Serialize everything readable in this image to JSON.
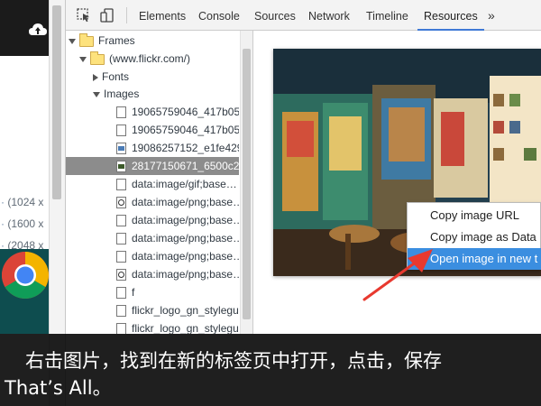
{
  "toolbar": {
    "tabs": [
      "Elements",
      "Console",
      "Sources",
      "Network",
      "Timeline",
      "Resources"
    ],
    "active_tab": "Resources",
    "more": "»"
  },
  "page_strip": {
    "resolutions": [
      "(1024 x",
      "(1600 x",
      "(2048 x"
    ]
  },
  "tree": {
    "frames": "Frames",
    "site": "(www.flickr.com/)",
    "fonts": "Fonts",
    "images": "Images",
    "items": [
      {
        "label": "19065759046_417b05",
        "icon": "file-icon"
      },
      {
        "label": "19065759046_417b05",
        "icon": "file-icon"
      },
      {
        "label": "19086257152_e1fe429",
        "icon": "image-icon"
      },
      {
        "label": "28177150671_6500c2",
        "icon": "image-icon",
        "selected": true
      },
      {
        "label": "data:image/gif;base…",
        "icon": "file-icon"
      },
      {
        "label": "data:image/png;base…",
        "icon": "search-file-icon"
      },
      {
        "label": "data:image/png;base…",
        "icon": "file-icon"
      },
      {
        "label": "data:image/png;base…",
        "icon": "file-icon"
      },
      {
        "label": "data:image/png;base…",
        "icon": "file-icon"
      },
      {
        "label": "data:image/png;base…",
        "icon": "search-file-icon"
      },
      {
        "label": "f",
        "icon": "file-icon"
      },
      {
        "label": "flickr_logo_gn_stylegu",
        "icon": "file-icon"
      },
      {
        "label": "flickr_logo_gn_stylegu",
        "icon": "file-icon"
      }
    ]
  },
  "context_menu": {
    "items": [
      "Copy image URL",
      "Copy image as Data",
      "Open image in new t"
    ],
    "highlighted_index": 2
  },
  "caption": {
    "line1": "右击图片，找到在新的标签页中打开，点击，保存",
    "line2": "That’s All。"
  },
  "colors": {
    "accent": "#3b8ee0",
    "selection": "#8c8c8c",
    "arrow": "#e8392f",
    "caption_bg": "#000000"
  }
}
